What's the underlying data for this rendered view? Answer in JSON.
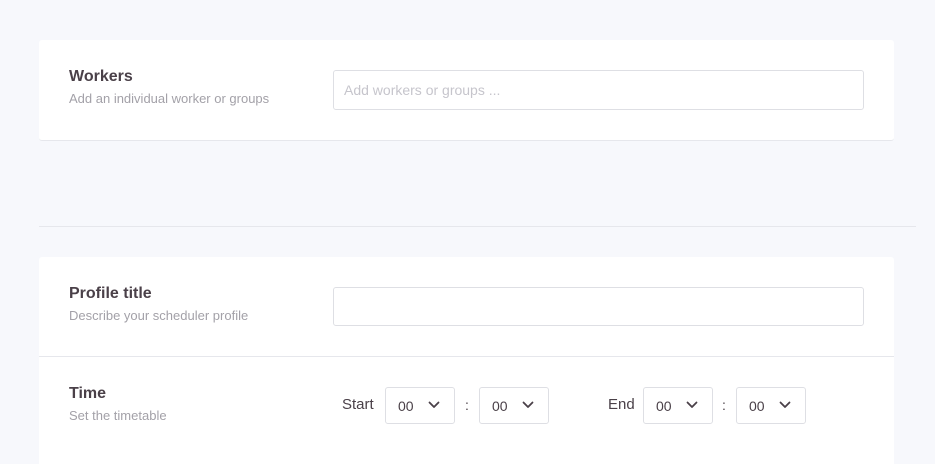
{
  "workers": {
    "title": "Workers",
    "description": "Add an individual worker or groups",
    "input_placeholder": "Add workers or groups ...",
    "input_value": ""
  },
  "profile": {
    "title": "Profile title",
    "description": "Describe your scheduler profile",
    "input_value": ""
  },
  "time": {
    "title": "Time",
    "description": "Set the timetable",
    "start_label": "Start",
    "end_label": "End",
    "separator": ":",
    "start_hour": "00",
    "start_minute": "00",
    "end_hour": "00",
    "end_minute": "00"
  },
  "icons": {
    "dropdown": "chevron-down-icon"
  },
  "colors": {
    "background": "#f7f8fc",
    "card": "#ffffff",
    "text_primary": "#4a4048",
    "text_secondary": "#a3a1a8",
    "border": "#dedfe4"
  }
}
